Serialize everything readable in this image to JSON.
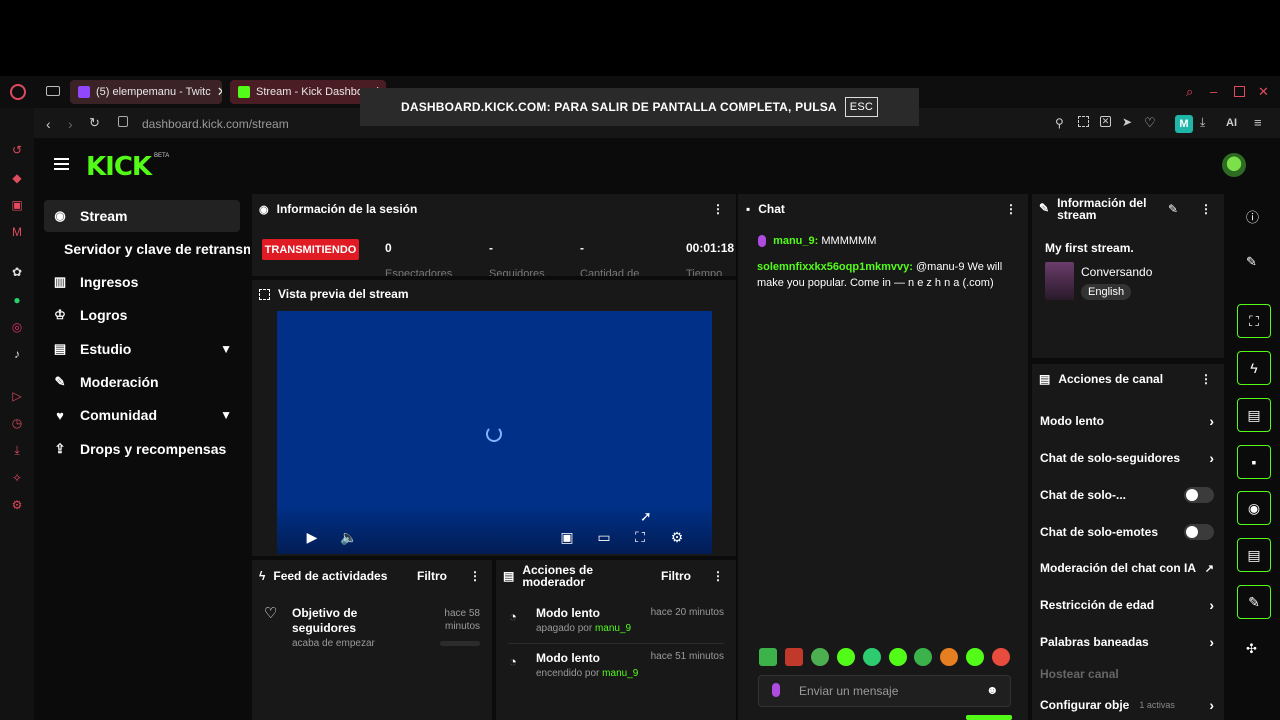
{
  "browser": {
    "tabs": [
      {
        "label": "(5) elempemanu - Twitc",
        "color": "#9146ff"
      },
      {
        "label": "Stream - Kick Dashboard",
        "color": "#53fc18"
      }
    ],
    "url": "dashboard.kick.com/stream",
    "fullscreen_notice": "DASHBOARD.KICK.COM: PARA SALIR DE PANTALLA COMPLETA, PULSA",
    "esc_key": "ESC",
    "ai_label": "AI",
    "profile_letter": "M"
  },
  "app": {
    "logo": "KICK",
    "beta": "BETA",
    "nav": [
      {
        "label": "Stream",
        "icon": "broadcast-icon",
        "active": true
      },
      {
        "label": "Servidor y clave de retransmisión"
      },
      {
        "label": "Ingresos",
        "icon": "chart-icon"
      },
      {
        "label": "Logros",
        "icon": "trophy-icon"
      },
      {
        "label": "Estudio",
        "icon": "studio-icon",
        "expandable": true
      },
      {
        "label": "Moderación",
        "icon": "wrench-icon"
      },
      {
        "label": "Comunidad",
        "icon": "community-icon",
        "expandable": true
      },
      {
        "label": "Drops y recompensas",
        "icon": "drops-icon"
      }
    ]
  },
  "session": {
    "title": "Información de la sesión",
    "status": "TRANSMITIENDO",
    "stats": [
      {
        "value": "0",
        "label": "Espectadores"
      },
      {
        "value": "-",
        "label": "Seguidores"
      },
      {
        "value": "-",
        "label": "Cantidad de"
      },
      {
        "value": "00:01:18",
        "label": "Tiempo"
      }
    ]
  },
  "preview": {
    "title": "Vista previa del stream"
  },
  "activity_feed": {
    "title": "Feed de actividades",
    "filter": "Filtro",
    "items": [
      {
        "title": "Objetivo de seguidores",
        "sub": "acaba de empezar",
        "time": "hace 58 minutos"
      }
    ]
  },
  "mod_actions": {
    "title": "Acciones de moderador",
    "filter": "Filtro",
    "items": [
      {
        "title": "Modo lento",
        "sub_prefix": "apagado por",
        "user": "manu_9",
        "time": "hace 20 minutos"
      },
      {
        "title": "Modo lento",
        "sub_prefix": "encendido por",
        "user": "manu_9",
        "time": "hace 51 minutos"
      }
    ]
  },
  "chat": {
    "title": "Chat",
    "messages": [
      {
        "user": "manu_9:",
        "text": "MMMMMM"
      },
      {
        "user": "solemnfixxkx56oqp1mkmvvy:",
        "text": "@manu-9 We will make you popular. Come in — n e z h n a (.com)"
      }
    ],
    "placeholder": "Enviar un mensaje"
  },
  "stream_info": {
    "title": "Información del stream",
    "stream_title": "My first stream.",
    "category": "Conversando",
    "language": "English"
  },
  "channel_actions": {
    "title": "Acciones de canal",
    "items": [
      {
        "label": "Modo lento",
        "control": "arrow"
      },
      {
        "label": "Chat de solo-seguidores",
        "control": "arrow"
      },
      {
        "label": "Chat de solo-...",
        "control": "toggle"
      },
      {
        "label": "Chat de solo-emotes",
        "control": "toggle"
      },
      {
        "label": "Moderación del chat con IA",
        "control": "external"
      },
      {
        "label": "Restricción de edad",
        "control": "arrow"
      },
      {
        "label": "Palabras baneadas",
        "control": "arrow"
      }
    ],
    "host_label": "Hostear canal",
    "configure_label": "Configurar obje",
    "configure_badge": "1 activas"
  },
  "colors": {
    "brand": "#53fc18",
    "live": "#e01b24",
    "panel": "#181818",
    "background": "#0b0b0b"
  }
}
